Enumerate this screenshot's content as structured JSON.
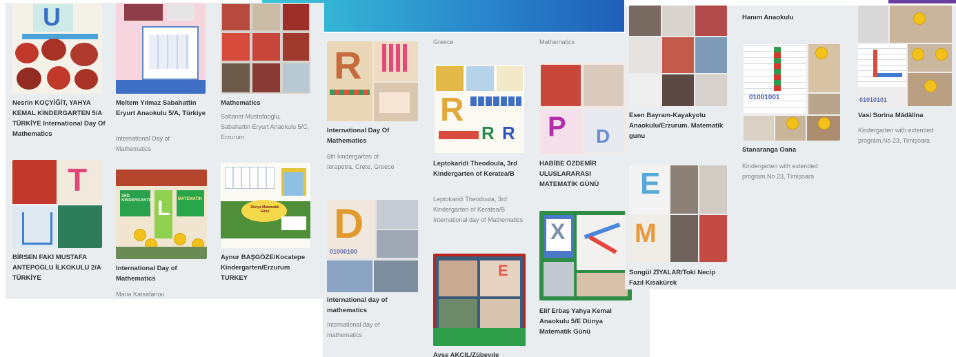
{
  "panel_left": {
    "cards": [
      {
        "title": "Nesrin KOÇYİĞİT, YAHYA KEMAL KINDERGARTEN 5/A TÜRKİYE International Day Of Mathematics",
        "subtitle": ""
      },
      {
        "title": "Meltem Yılmaz Sabahattin Eryurt Anaokulu 5/A, Türkiye",
        "subtitle": "International Day of Mathematics"
      },
      {
        "title": "Mathematics",
        "subtitle": "Saltanat Mustafaoglu, Sabahattin Eryurt Anaokulu 5/C, Erzurum"
      },
      {
        "title": "BİRSEN FAKI MUSTAFA ANTEPOGLU İLKOKULU 2/A TÜRKİYE",
        "subtitle": ""
      },
      {
        "title": "International Day of Mathematics",
        "subtitle": "Maria Katsafanou"
      },
      {
        "title": "Aynur BAŞGÖZE/Kocatepe Kindergarten/Erzurum TURKEY",
        "subtitle": ""
      }
    ]
  },
  "panel_middle": {
    "header_remnants": [
      "Greece",
      "Mathematics"
    ],
    "cards": [
      {
        "title": "International Day Of Mathematics",
        "subtitle": "6th kindergarten of Ierapetra, Crete, Greece"
      },
      {
        "title": "Leptokaridi Theodoula, 3rd Kindergarten of Keratea/B",
        "subtitle": "Leptokaridi Theodoula, 3rd Kindergarten of Keratea/B International day of Mathematics"
      },
      {
        "title": "HABİBE ÖZDEMİR ULUSLARARASI MATEMATİK GÜNÜ",
        "subtitle": ""
      },
      {
        "title": "International day of mathematics",
        "subtitle": "International day of mathematics"
      },
      {
        "title": "Elif Erbaş Yahya Kemal Anaokulu 5/E Dünya Matematik Günü",
        "subtitle": ""
      },
      {
        "title": "Ayşe AKÇIL/Zübeyde",
        "subtitle": ""
      }
    ]
  },
  "panel_right": {
    "header_remnant": "Hanım Anaokulu",
    "cards": [
      {
        "title": "Esen Bayram-Kayakyolu Anaokulu/Erzurum. Matematik gunu",
        "subtitle": ""
      },
      {
        "title": "Stanaranga Oana",
        "subtitle": "Kindergarten with extended program,No 23, Timișoara"
      },
      {
        "title": "Vasi Sorina Mădălina",
        "subtitle": "Kindergarten with extended program,No 23, Timișoara"
      },
      {
        "title": "Songül ZİYALAR/Toki Necip Fazıl Kısakürek",
        "subtitle": ""
      }
    ]
  },
  "thumb_labels": {
    "letter_u": "U",
    "letter_t": "T",
    "letter_l": "L",
    "letter_r": "R",
    "letter_p": "P",
    "letter_d": "D",
    "letter_e": "E",
    "letter_x": "X",
    "letter_m": "M",
    "binary_1": "01000100",
    "binary_2": "01001001",
    "binary_3": "01010101",
    "sign_1": "3RD KINDERGARTEN",
    "sign_2": "MATEMATİK",
    "sign_3": "Dünya Matematik Günü"
  },
  "colors": {
    "panel_bg": "#e9edef",
    "banner_gradient_start": "#39c7d8",
    "banner_gradient_end": "#1f5fb8",
    "accent_purple": "#6b3fa0"
  }
}
